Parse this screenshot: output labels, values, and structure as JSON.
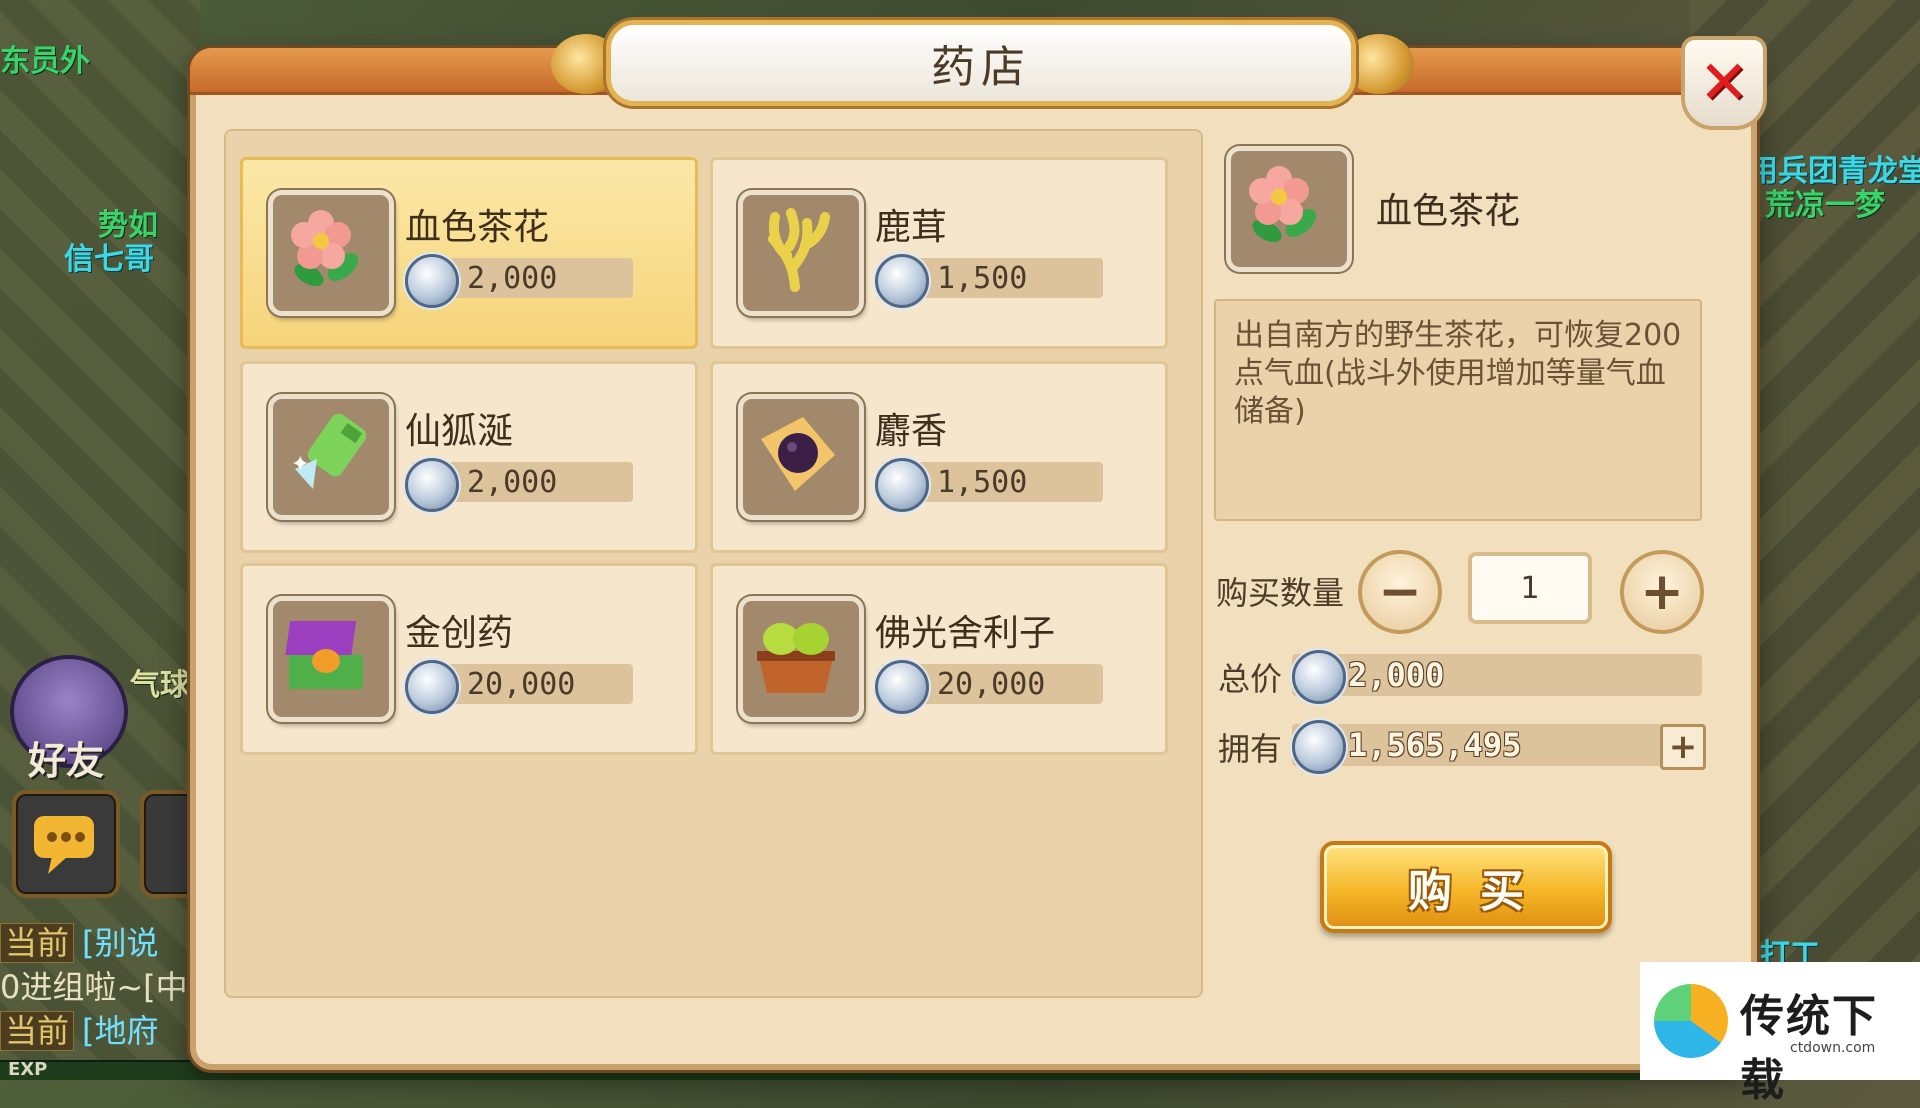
{
  "shop": {
    "title": "药店",
    "items": [
      {
        "name": "血色茶花",
        "price": "2,000",
        "icon": "camellia-flower-icon",
        "selected": true
      },
      {
        "name": "鹿茸",
        "price": "1,500",
        "icon": "antler-icon",
        "selected": false
      },
      {
        "name": "仙狐涎",
        "price": "2,000",
        "icon": "green-bottle-icon",
        "selected": false
      },
      {
        "name": "麝香",
        "price": "1,500",
        "icon": "musk-icon",
        "selected": false
      },
      {
        "name": "金创药",
        "price": "20,000",
        "icon": "medicine-box-icon",
        "selected": false
      },
      {
        "name": "佛光舍利子",
        "price": "20,000",
        "icon": "relic-beads-icon",
        "selected": false
      }
    ]
  },
  "detail": {
    "name": "血色茶花",
    "description": "出自南方的野生茶花，可恢复200点气血(战斗外使用增加等量气血储备)",
    "qty_label": "购买数量",
    "quantity": "1",
    "total_label": "总价",
    "total_value": "2,000",
    "owned_label": "拥有",
    "owned_value": "1,565,495",
    "buy_label": "购买"
  },
  "background": {
    "npc_names": [
      "东员外",
      "势如",
      "信七哥",
      "用兵团青龙堂",
      "荒凉一梦",
      "气球",
      "打工"
    ],
    "friend_label": "好友",
    "chat": [
      {
        "tag": "当前",
        "text": "[别说"
      },
      {
        "tag": "",
        "text": "0进组啦~[中"
      },
      {
        "tag": "当前",
        "text": "[地府"
      }
    ],
    "exp_label": "EXP"
  },
  "watermark": {
    "title": "传统下载",
    "url": "ctdown.com"
  },
  "colors": {
    "panel_bg": "#f1dfbd",
    "selected_item": "#f6d47a",
    "buy_button": "#f5b626",
    "close_x": "#e21c1c"
  }
}
